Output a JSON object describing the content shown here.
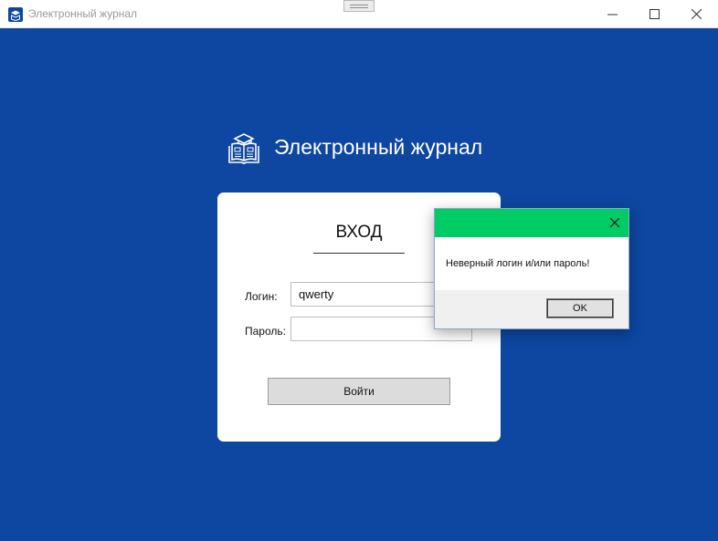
{
  "window": {
    "title": "Электронный журнал",
    "minimize_glyph": "—",
    "maximize_glyph": "☐",
    "close_glyph": "✕",
    "app_icon": "journal-icon"
  },
  "header": {
    "title": "Электронный журнал",
    "logo_icon": "book-graduation-cap-icon"
  },
  "login": {
    "title": "ВХОД",
    "login_label": "Логин:",
    "login_value": "qwerty",
    "password_label": "Пароль:",
    "password_value": "",
    "submit_label": "Войти"
  },
  "dialog": {
    "message": "Неверный логин и/или пароль!",
    "ok_label": "OK",
    "accent_color": "#00cc66"
  },
  "colors": {
    "background": "#0d47a1",
    "card": "#ffffff"
  }
}
